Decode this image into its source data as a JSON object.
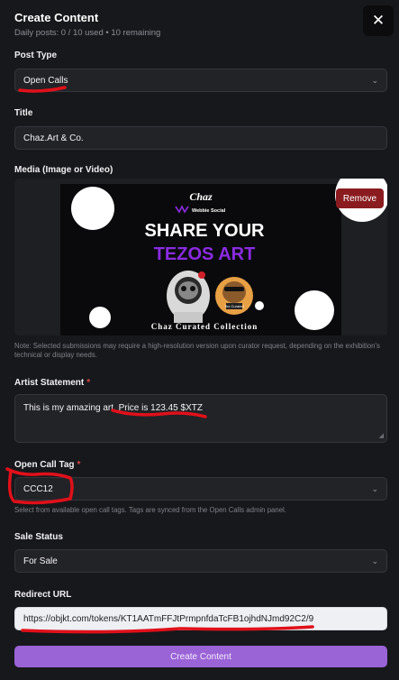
{
  "header": {
    "title": "Create Content",
    "subtitle": "Daily posts: 0 / 10 used • 10 remaining",
    "close_icon": "close-icon"
  },
  "post_type": {
    "label": "Post Type",
    "value": "Open Calls"
  },
  "title_field": {
    "label": "Title",
    "value": "Chaz.Art & Co."
  },
  "media": {
    "label": "Media (Image or Video)",
    "remove_label": "Remove",
    "image": {
      "logo_text": "Chaz",
      "brand_text": "Webbie Social",
      "headline_line1": "SHARE YOUR",
      "headline_line2": "TEZOS ART",
      "footer_text": "Chaz Curated Collection",
      "badge_text": "Tez Curated",
      "colors": {
        "headline": "#ffffff",
        "accent": "#8a2be2",
        "background": "#0a0a0c"
      }
    },
    "note": "Note: Selected submissions may require a high-resolution version upon curator request, depending on the exhibition's technical or display needs."
  },
  "artist_statement": {
    "label": "Artist Statement",
    "required": "*",
    "value": "This is my amazing art. Price is 123.45 $XTZ"
  },
  "open_call_tag": {
    "label": "Open Call Tag",
    "required": "*",
    "value": "CCC12",
    "help": "Select from available open call tags. Tags are synced from the Open Calls admin panel."
  },
  "sale_status": {
    "label": "Sale Status",
    "value": "For Sale"
  },
  "redirect_url": {
    "label": "Redirect URL",
    "value": "https://objkt.com/tokens/KT1AATmFFJtPrmpnfdaTcFB1ojhdNJmd92C2/9"
  },
  "submit": {
    "label": "Create Content"
  },
  "colors": {
    "annotation": "#e0101a",
    "primary": "#9a63d6",
    "danger": "#8a1c1f"
  }
}
